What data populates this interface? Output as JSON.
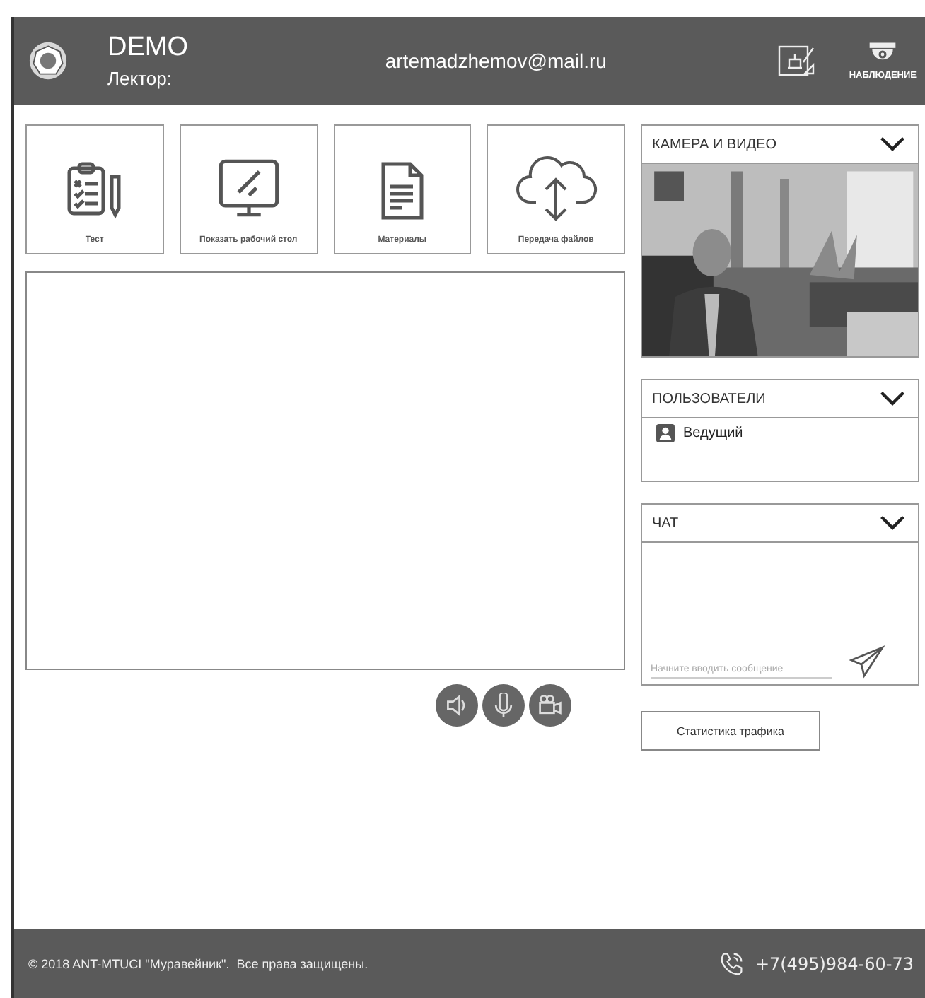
{
  "header": {
    "title": "DEMO",
    "subtitle": "Лектор:",
    "email": "artemadzhemov@mail.ru",
    "surveillance_label": "НАБЛЮДЕНИЕ"
  },
  "tools": [
    {
      "kind": "test",
      "label": "Тест"
    },
    {
      "kind": "desktop",
      "label": "Показать рабочий стол"
    },
    {
      "kind": "materials",
      "label": "Материалы"
    },
    {
      "kind": "transfer",
      "label": "Передача файлов"
    }
  ],
  "camera_panel": {
    "title": "КАМЕРА И ВИДЕО"
  },
  "users_panel": {
    "title": "ПОЛЬЗОВАТЕЛИ",
    "users": [
      "Ведущий"
    ]
  },
  "chat_panel": {
    "title": "ЧАТ",
    "input": {
      "placeholder": "Начните вводить сообщение"
    }
  },
  "media_controls": [
    {
      "kind": "speaker"
    },
    {
      "kind": "microphone"
    },
    {
      "kind": "camera"
    }
  ],
  "traffic_button": "Статистика трафика",
  "footer": {
    "copyright": "© 2018 ANT-MTUCI \"Муравейник\".  Все права защищены.",
    "phone": "+7(495)984-60-73"
  }
}
